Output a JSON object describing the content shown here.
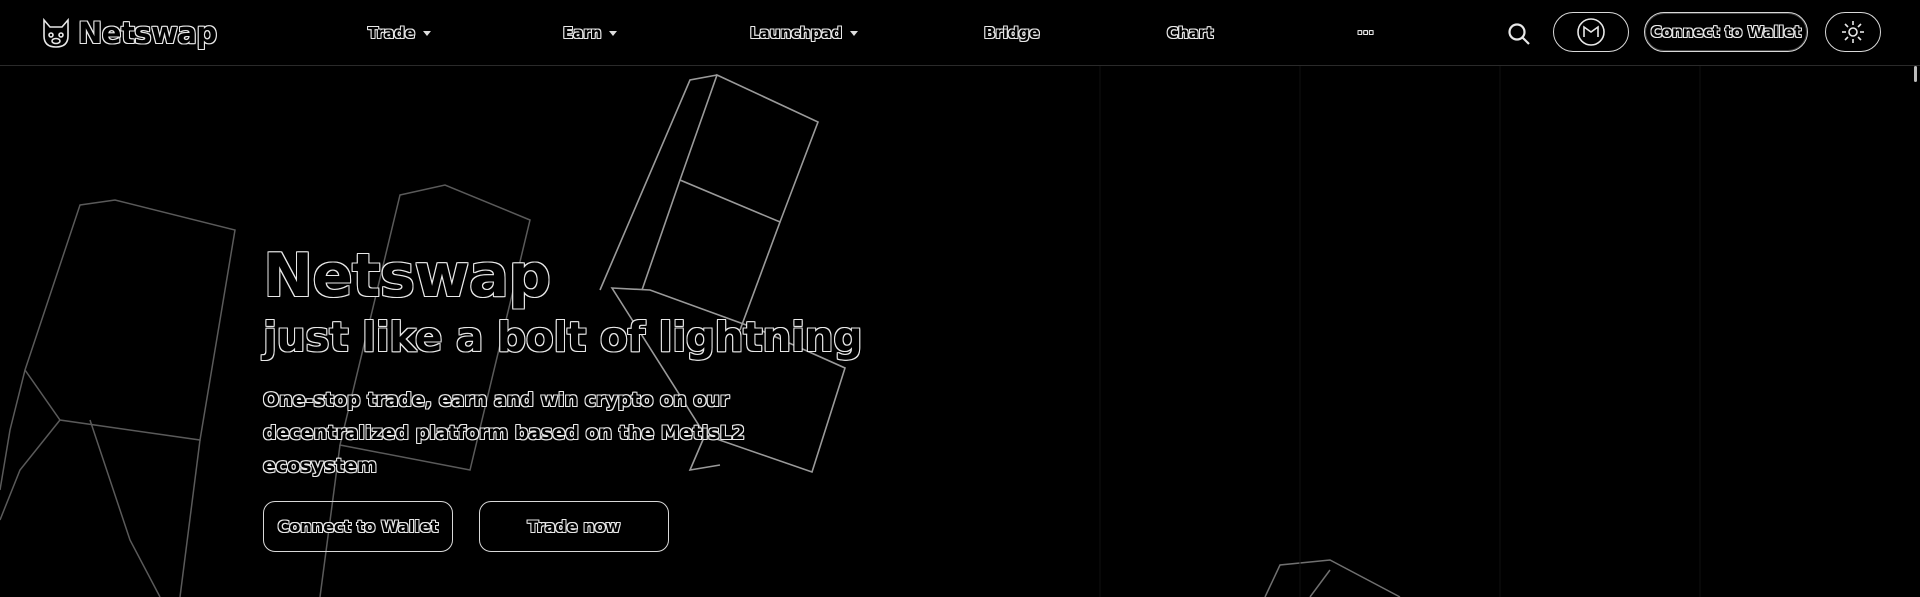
{
  "header": {
    "logo_text": "Netswap",
    "nav": [
      {
        "label": "Trade",
        "has_dropdown": true
      },
      {
        "label": "Earn",
        "has_dropdown": true
      },
      {
        "label": "Launchpad",
        "has_dropdown": true
      },
      {
        "label": "Bridge",
        "has_dropdown": false
      },
      {
        "label": "Chart",
        "has_dropdown": false
      },
      {
        "label": "···",
        "has_dropdown": false
      }
    ],
    "connect_label": "Connect to Wallet",
    "icons": [
      "search-icon",
      "metis-token-icon",
      "theme-toggle-icon"
    ]
  },
  "hero": {
    "title": "Netswap",
    "subtitle": "just like a bolt of lightning",
    "description": "One-stop trade, earn and win crypto on our decentralized platform based on the MetisL2 ecosystem",
    "primary_cta": "Connect to Wallet",
    "secondary_cta": "Trade now"
  },
  "colors": {
    "background": "#000000",
    "outline": "#e8e8e8"
  }
}
